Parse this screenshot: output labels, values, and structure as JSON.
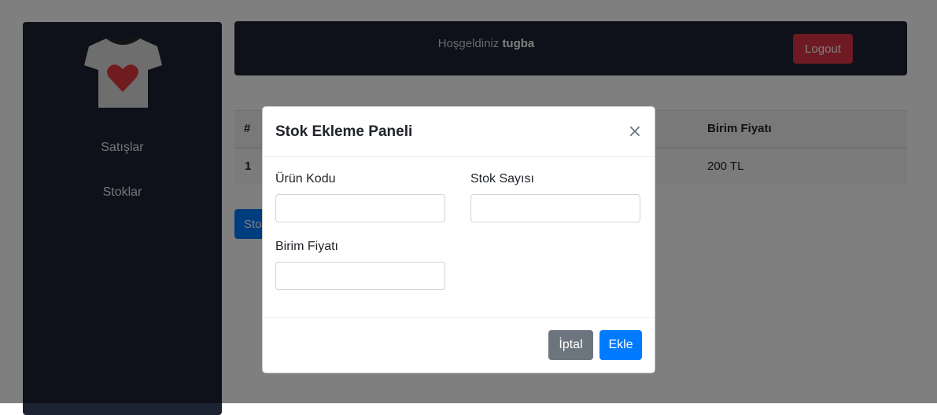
{
  "colors": {
    "sidebar": "#1c2333",
    "logout": "#dc3545",
    "primary": "#007bff",
    "secondary": "#6c757d"
  },
  "sidebar": {
    "logo_icon": "tshirt-heart-icon",
    "items": [
      {
        "label": "Satışlar"
      },
      {
        "label": "Stoklar"
      }
    ]
  },
  "header": {
    "welcome_prefix": "Hoşgeldiniz",
    "username": "tugba",
    "logout_label": "Logout"
  },
  "table": {
    "columns": [
      "#",
      "Birim Fiyatı"
    ],
    "rows": [
      {
        "index": "1",
        "price": "200 TL"
      }
    ]
  },
  "add_stock_button_label": "Sto",
  "modal": {
    "title": "Stok Ekleme Paneli",
    "close_icon": "close-icon",
    "fields": {
      "product_code": {
        "label": "Ürün Kodu",
        "value": "",
        "placeholder": ""
      },
      "stock_count": {
        "label": "Stok Sayısı",
        "value": "",
        "placeholder": ""
      },
      "unit_price": {
        "label": "Birim Fiyatı",
        "value": "",
        "placeholder": ""
      }
    },
    "cancel_label": "İptal",
    "add_label": "Ekle"
  }
}
